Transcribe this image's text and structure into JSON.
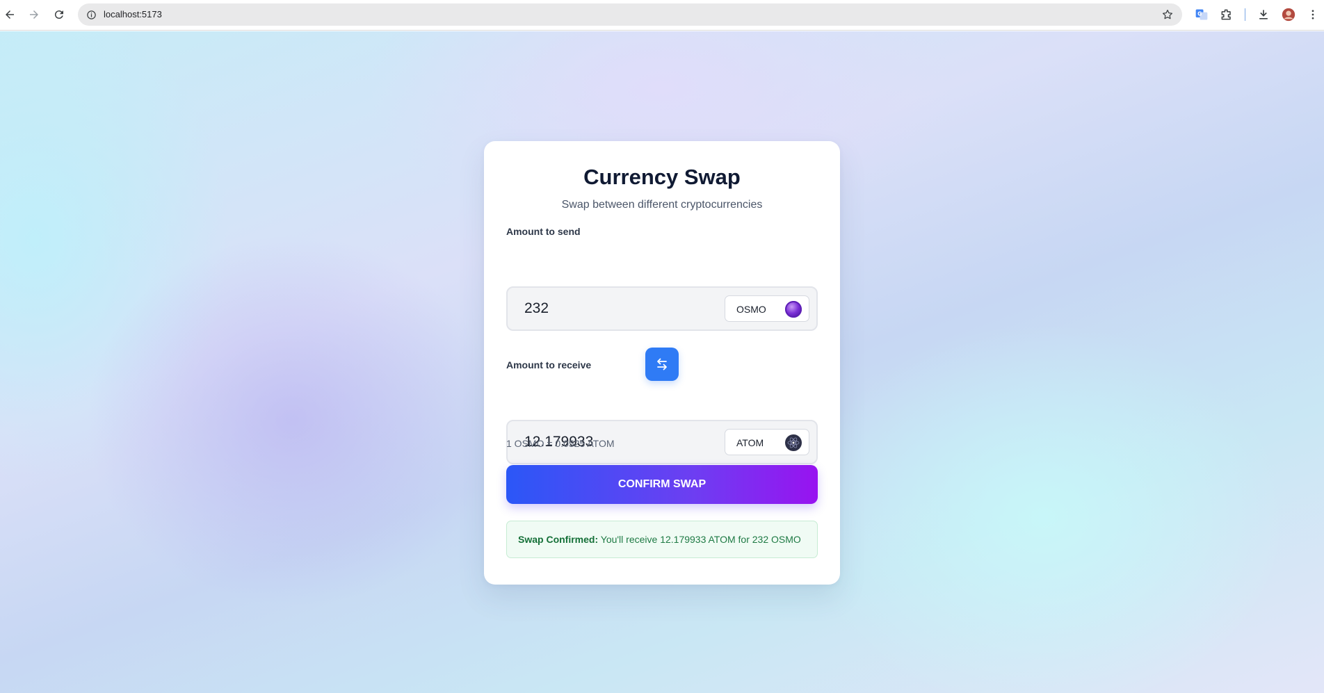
{
  "browser": {
    "url": "localhost:5173",
    "icons": [
      "back-arrow-icon",
      "forward-arrow-icon",
      "reload-icon",
      "site-info-icon",
      "bookmark-star-icon",
      "translate-icon",
      "extensions-icon",
      "download-icon",
      "profile-avatar",
      "more-menu-icon"
    ]
  },
  "card": {
    "title": "Currency Swap",
    "subtitle": "Swap between different cryptocurrencies",
    "send": {
      "label": "Amount to send",
      "value": "232",
      "token": "OSMO",
      "token_icon": "osmo-logo-icon"
    },
    "swap_button_icon": "swap-arrows-icon",
    "receive": {
      "label": "Amount to receive",
      "value": "12.179933",
      "token": "ATOM",
      "token_icon": "atom-logo-icon"
    },
    "rate": "1 OSMO = 0.0525 ATOM",
    "confirm_label": "CONFIRM SWAP",
    "result": {
      "bold": "Swap Confirmed:",
      "message": " You'll receive 12.179933 ATOM for 232 OSMO"
    }
  },
  "colors": {
    "accent_blue": "#2f7bf5",
    "gradient_start": "#2b57f7",
    "gradient_end": "#9813f0",
    "success_text": "#1e7a44"
  }
}
